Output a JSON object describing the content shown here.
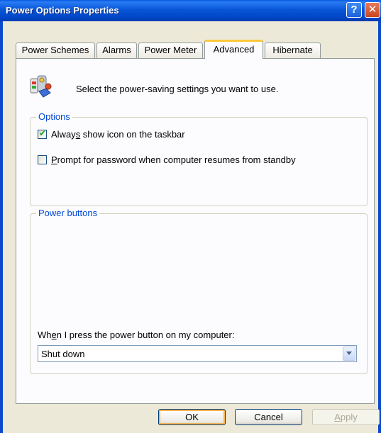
{
  "window": {
    "title": "Power Options Properties",
    "help_glyph": "?",
    "close_glyph": "✕"
  },
  "tabs": [
    {
      "label": "Power Schemes",
      "active": false
    },
    {
      "label": "Alarms",
      "active": false
    },
    {
      "label": "Power Meter",
      "active": false
    },
    {
      "label": "Advanced",
      "active": true
    },
    {
      "label": "Hibernate",
      "active": false
    }
  ],
  "header": {
    "icon": "power-settings-icon",
    "text": "Select the power-saving settings you want to use."
  },
  "options": {
    "legend": "Options",
    "always_show_icon": {
      "pre": "Alway",
      "accel": "s",
      "post": " show icon on the taskbar",
      "checked": true
    },
    "prompt_password": {
      "pre": "",
      "accel": "P",
      "post": "rompt for password when computer resumes from standby",
      "checked": false
    }
  },
  "power_buttons": {
    "legend": "Power buttons",
    "label_pre": "Wh",
    "label_accel": "e",
    "label_post": "n I press the power button on my computer:",
    "selected": "Shut down"
  },
  "buttons": {
    "ok": "OK",
    "cancel": "Cancel",
    "apply_accel": "A",
    "apply_rest": "pply"
  },
  "colors": {
    "titlebar": "#0856d6",
    "group_legend": "#0046d5",
    "active_tab_accent": "#ffc83c",
    "checkmark": "#21a121"
  }
}
